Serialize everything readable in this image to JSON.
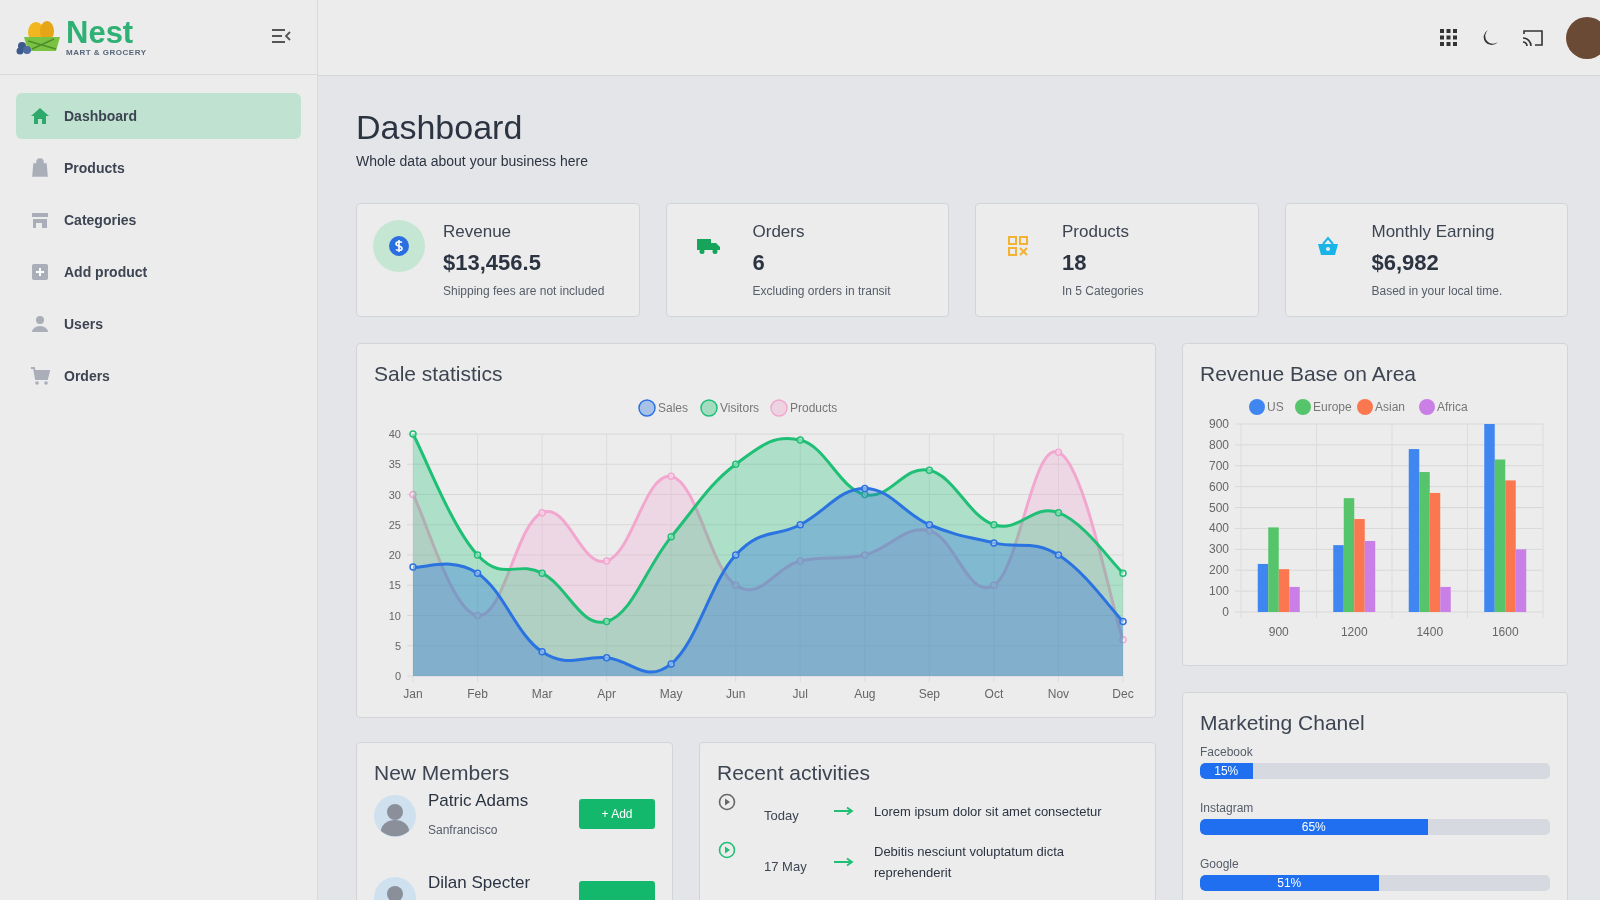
{
  "brand": {
    "name": "Nest",
    "tagline": "MART & GROCERY"
  },
  "sidebar": {
    "items": [
      {
        "label": "Dashboard",
        "selected": true
      },
      {
        "label": "Products",
        "selected": false
      },
      {
        "label": "Categories",
        "selected": false
      },
      {
        "label": "Add product",
        "selected": false
      },
      {
        "label": "Users",
        "selected": false
      },
      {
        "label": "Orders",
        "selected": false
      }
    ]
  },
  "page": {
    "title": "Dashboard",
    "subtitle": "Whole data about your business here"
  },
  "stats": [
    {
      "label": "Revenue",
      "value": "$13,456.5",
      "note": "Shipping fees are not included"
    },
    {
      "label": "Orders",
      "value": "6",
      "note": "Excluding orders in transit"
    },
    {
      "label": "Products",
      "value": "18",
      "note": "In 5 Categories"
    },
    {
      "label": "Monthly Earning",
      "value": "$6,982",
      "note": "Based in your local time."
    }
  ],
  "sale_statistics": {
    "title": "Sale statistics",
    "chart_data": {
      "type": "area",
      "grid": true,
      "legend": "top",
      "categories": [
        "Jan",
        "Feb",
        "Mar",
        "Apr",
        "May",
        "Jun",
        "Jul",
        "Aug",
        "Sep",
        "Oct",
        "Nov",
        "Dec"
      ],
      "ylim": [
        0,
        40
      ],
      "yticks": [
        0,
        5,
        10,
        15,
        20,
        25,
        30,
        35,
        40
      ],
      "series": [
        {
          "name": "Sales",
          "color": "#2a73e0",
          "values": [
            18,
            17,
            4,
            3,
            2,
            20,
            25,
            31,
            25,
            22,
            20,
            9
          ]
        },
        {
          "name": "Visitors",
          "color": "#1fbf75",
          "values": [
            40,
            20,
            17,
            9,
            23,
            35,
            39,
            30,
            34,
            25,
            27,
            17
          ]
        },
        {
          "name": "Products",
          "color": "#f2a7cf",
          "values": [
            30,
            10,
            27,
            19,
            33,
            15,
            19,
            20,
            24,
            15,
            37,
            6
          ]
        }
      ]
    }
  },
  "revenue_by_area": {
    "title": "Revenue Base on Area",
    "chart_data": {
      "type": "bar",
      "grid": true,
      "legend": "top",
      "categories": [
        "900",
        "1200",
        "1400",
        "1600"
      ],
      "ylim": [
        0,
        900
      ],
      "yticks": [
        0,
        100,
        200,
        300,
        400,
        500,
        600,
        700,
        800,
        900
      ],
      "series": [
        {
          "name": "US",
          "color": "#3f86f0",
          "values": [
            230,
            320,
            780,
            900
          ]
        },
        {
          "name": "Europe",
          "color": "#55c46a",
          "values": [
            405,
            545,
            670,
            730
          ]
        },
        {
          "name": "Asian",
          "color": "#fb7750",
          "values": [
            205,
            445,
            570,
            630
          ]
        },
        {
          "name": "Africa",
          "color": "#c97fe6",
          "values": [
            120,
            340,
            120,
            300
          ]
        }
      ]
    }
  },
  "new_members": {
    "title": "New Members",
    "members": [
      {
        "name": "Patric Adams",
        "location": "Sanfrancisco",
        "button": "+ Add"
      },
      {
        "name": "Dilan Specter"
      }
    ]
  },
  "recent_activities": {
    "title": "Recent activities",
    "items": [
      {
        "date": "Today",
        "text": "Lorem ipsum dolor sit amet consectetur",
        "active": false
      },
      {
        "date": "17 May",
        "text": "Debitis nesciunt voluptatum dicta reprehenderit",
        "active": true
      }
    ]
  },
  "marketing": {
    "title": "Marketing Chanel",
    "channels": [
      {
        "name": "Facebook",
        "level": 0.15,
        "reading": "15%"
      },
      {
        "name": "Instagram",
        "level": 0.65,
        "reading": "65%"
      },
      {
        "name": "Google",
        "level": 0.51,
        "reading": "51%"
      }
    ]
  }
}
